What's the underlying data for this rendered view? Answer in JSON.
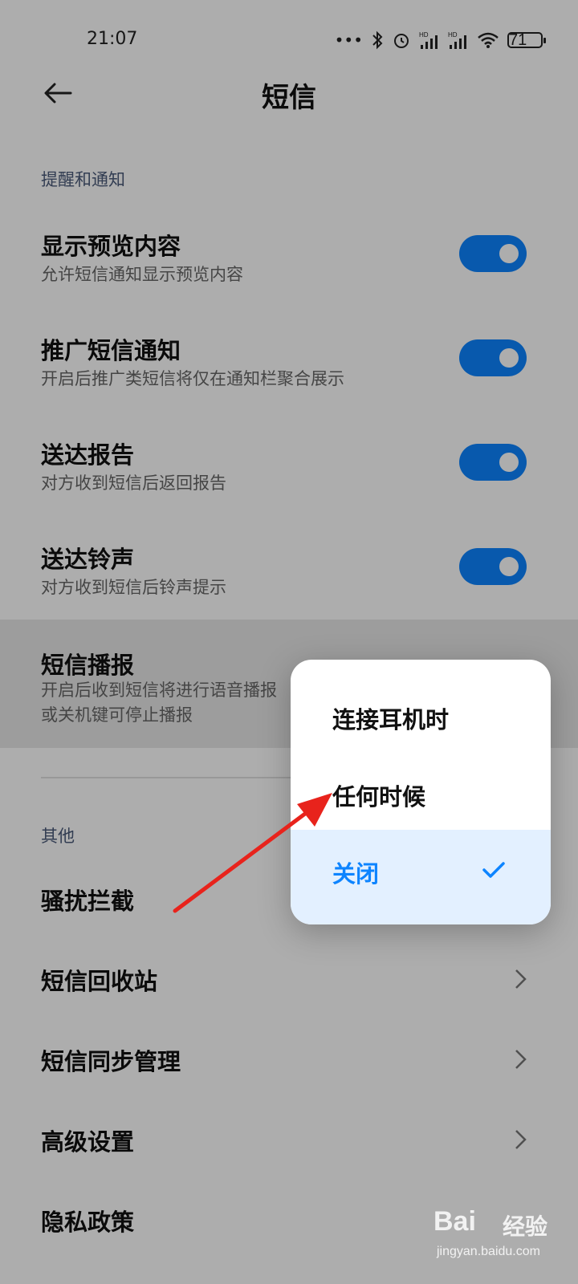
{
  "status_bar": {
    "time": "21:07",
    "battery": "71",
    "signal_1": "HD",
    "signal_2": "HD"
  },
  "header": {
    "title": "短信"
  },
  "sections": {
    "notifications_header": "提醒和通知",
    "other_header": "其他"
  },
  "settings": [
    {
      "title": "显示预览内容",
      "desc": "允许短信通知显示预览内容",
      "enabled": true
    },
    {
      "title": "推广短信通知",
      "desc": "开启后推广类短信将仅在通知栏聚合展示",
      "enabled": true
    },
    {
      "title": "送达报告",
      "desc": "对方收到短信后返回报告",
      "enabled": true
    },
    {
      "title": "送达铃声",
      "desc": "对方收到短信后铃声提示",
      "enabled": true
    }
  ],
  "sms_broadcast": {
    "title": "短信播报",
    "desc_line1": "开启后收到短信将进行语音播报",
    "desc_line2": "或关机键可停止播报"
  },
  "nav_items": [
    {
      "label": "骚扰拦截"
    },
    {
      "label": "短信回收站"
    },
    {
      "label": "短信同步管理"
    },
    {
      "label": "高级设置"
    },
    {
      "label": "隐私政策"
    }
  ],
  "popup": {
    "options": [
      {
        "label": "连接耳机时",
        "selected": false
      },
      {
        "label": "任何时候",
        "selected": false
      },
      {
        "label": "关闭",
        "selected": true
      }
    ]
  },
  "watermark": {
    "brand": "Bai",
    "cn": "经验",
    "url": "jingyan.baidu.com"
  },
  "colors": {
    "accent": "#0d84ff",
    "annotation_arrow": "#e8231c",
    "selected_bg": "#e3f0ff"
  }
}
